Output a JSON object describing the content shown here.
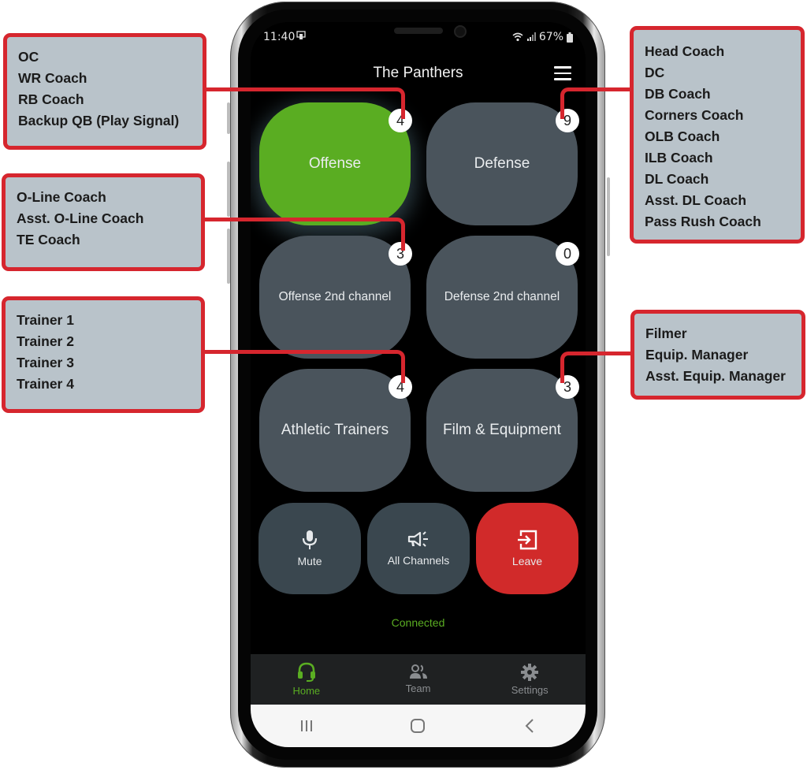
{
  "status_bar": {
    "time": "11:40",
    "battery": "67%",
    "icons": [
      "notification-icon",
      "wifi-icon",
      "signal-icon",
      "battery-icon"
    ]
  },
  "header": {
    "title": "The Panthers",
    "menu_icon": "hamburger-menu-icon"
  },
  "channels": [
    {
      "label": "Offense",
      "count": "4",
      "active": true
    },
    {
      "label": "Defense",
      "count": "9",
      "active": false
    },
    {
      "label": "Offense 2nd channel",
      "count": "3",
      "active": false
    },
    {
      "label": "Defense 2nd channel",
      "count": "0",
      "active": false
    },
    {
      "label": "Athletic Trainers",
      "count": "4",
      "active": false
    },
    {
      "label": "Film & Equipment",
      "count": "3",
      "active": false
    }
  ],
  "actions": [
    {
      "label": "Mute",
      "icon": "microphone-icon"
    },
    {
      "label": "All Channels",
      "icon": "megaphone-icon"
    },
    {
      "label": "Leave",
      "icon": "exit-icon"
    }
  ],
  "connection_status": "Connected",
  "bottom_nav": [
    {
      "label": "Home",
      "icon": "headset-icon",
      "active": true
    },
    {
      "label": "Team",
      "icon": "team-icon",
      "active": false
    },
    {
      "label": "Settings",
      "icon": "gear-icon",
      "active": false
    }
  ],
  "system_nav": [
    "recents-icon",
    "home-icon",
    "back-icon"
  ],
  "callouts": {
    "offense": [
      "OC",
      "WR Coach",
      "RB Coach",
      "Backup QB (Play Signal)"
    ],
    "offense_2nd": [
      "O-Line Coach",
      "Asst. O-Line Coach",
      "TE Coach"
    ],
    "trainers": [
      "Trainer 1",
      "Trainer 2",
      "Trainer 3",
      "Trainer 4"
    ],
    "defense": [
      "Head Coach",
      "DC",
      "DB Coach",
      "Corners Coach",
      "OLB Coach",
      "ILB Coach",
      "DL Coach",
      "Asst. DL Coach",
      "Pass Rush Coach"
    ],
    "film_equipment": [
      "Filmer",
      "Equip. Manager",
      "Asst. Equip. Manager"
    ]
  },
  "colors": {
    "accent_green": "#5aad22",
    "channel_gray": "#4a545c",
    "leave_red": "#d12a2a",
    "callout_red": "#d6262e",
    "callout_bg": "#b9c3ca"
  }
}
